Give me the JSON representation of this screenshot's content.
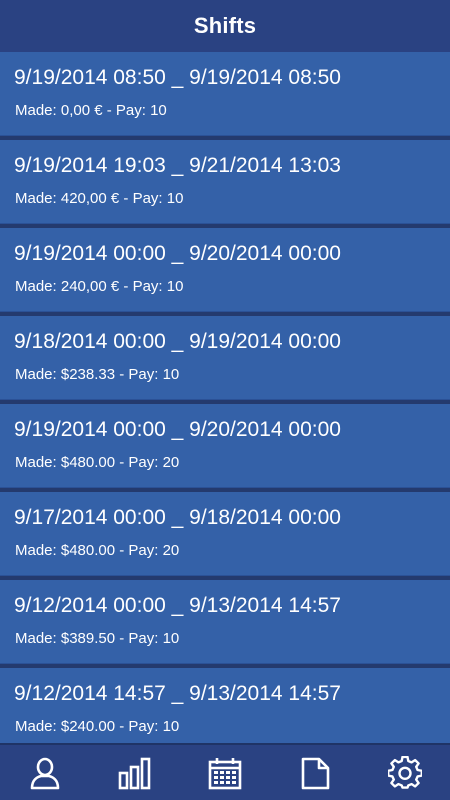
{
  "header": {
    "title": "Shifts"
  },
  "shifts": [
    {
      "range": "9/19/2014 08:50 _ 9/19/2014 08:50",
      "meta": "Made: 0,00 € - Pay: 10"
    },
    {
      "range": "9/19/2014 19:03 _ 9/21/2014 13:03",
      "meta": "Made: 420,00 € - Pay: 10"
    },
    {
      "range": "9/19/2014 00:00 _ 9/20/2014 00:00",
      "meta": "Made: 240,00 € - Pay: 10"
    },
    {
      "range": "9/18/2014 00:00 _ 9/19/2014 00:00",
      "meta": "Made: $238.33 - Pay: 10"
    },
    {
      "range": "9/19/2014 00:00 _ 9/20/2014 00:00",
      "meta": "Made: $480.00 - Pay: 20"
    },
    {
      "range": "9/17/2014 00:00 _ 9/18/2014 00:00",
      "meta": "Made: $480.00 - Pay: 20"
    },
    {
      "range": "9/12/2014 00:00 _ 9/13/2014 14:57",
      "meta": "Made: $389.50 - Pay: 10"
    },
    {
      "range": "9/12/2014 14:57 _ 9/13/2014 14:57",
      "meta": "Made: $240.00 - Pay: 10"
    }
  ],
  "bottom_nav": {
    "items": [
      {
        "icon": "person-icon"
      },
      {
        "icon": "bar-chart-icon"
      },
      {
        "icon": "calendar-icon"
      },
      {
        "icon": "document-icon"
      },
      {
        "icon": "gear-icon"
      }
    ]
  },
  "colors": {
    "header_bg": "#2a4282",
    "item_bg": "#3461a8",
    "separator": "#243a6e",
    "text": "#ffffff"
  }
}
